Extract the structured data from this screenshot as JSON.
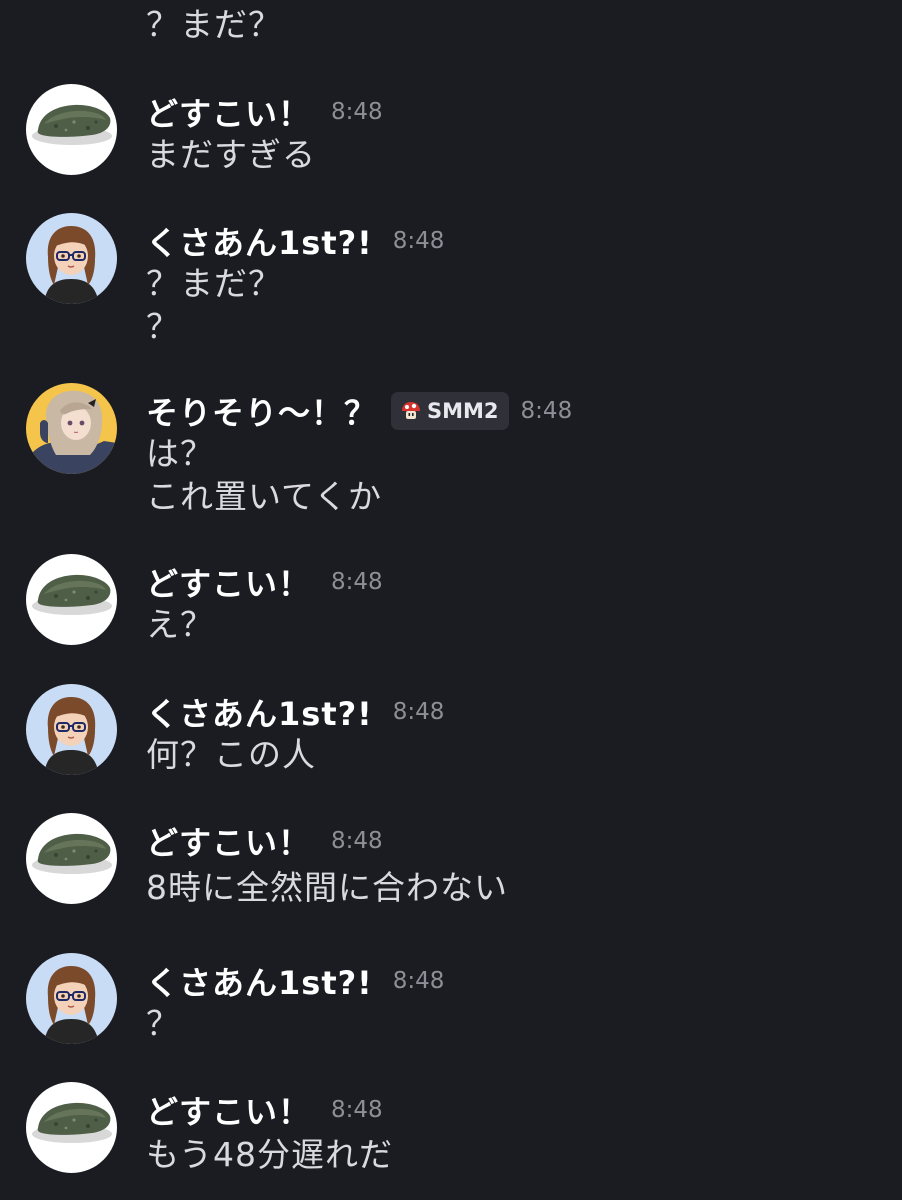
{
  "top_fragment": "？まだ？",
  "users": {
    "dosukoi": "どすこい！",
    "kusaan": "くさあん1st?!",
    "sorisori": "そりそり〜！？"
  },
  "tag": {
    "label": "SMM2",
    "icon": "mushroom-icon"
  },
  "messages": [
    {
      "user": "どすこい！",
      "time": "8:48",
      "lines": [
        "まだすぎる"
      ]
    },
    {
      "user": "くさあん1st?!",
      "time": "8:48",
      "lines": [
        "？まだ？",
        "？"
      ]
    },
    {
      "user": "そりそり〜！？",
      "time": "8:48",
      "lines": [
        "は？",
        "これ置いてくか"
      ]
    },
    {
      "user": "どすこい！",
      "time": "8:48",
      "lines": [
        "え？"
      ]
    },
    {
      "user": "くさあん1st?!",
      "time": "8:48",
      "lines": [
        "何？この人"
      ]
    },
    {
      "user": "どすこい！",
      "time": "8:48",
      "lines": [
        "8時に全然間に合わない"
      ]
    },
    {
      "user": "くさあん1st?!",
      "time": "8:48",
      "lines": [
        "？"
      ]
    },
    {
      "user": "どすこい！",
      "time": "8:48",
      "lines": [
        "もう48分遅れだ"
      ]
    }
  ],
  "colors": {
    "background": "#1b1c22",
    "username": "#ffffff",
    "message_text": "#d9d9de",
    "timestamp": "#8d8f97",
    "tag_background": "#2f3038"
  }
}
